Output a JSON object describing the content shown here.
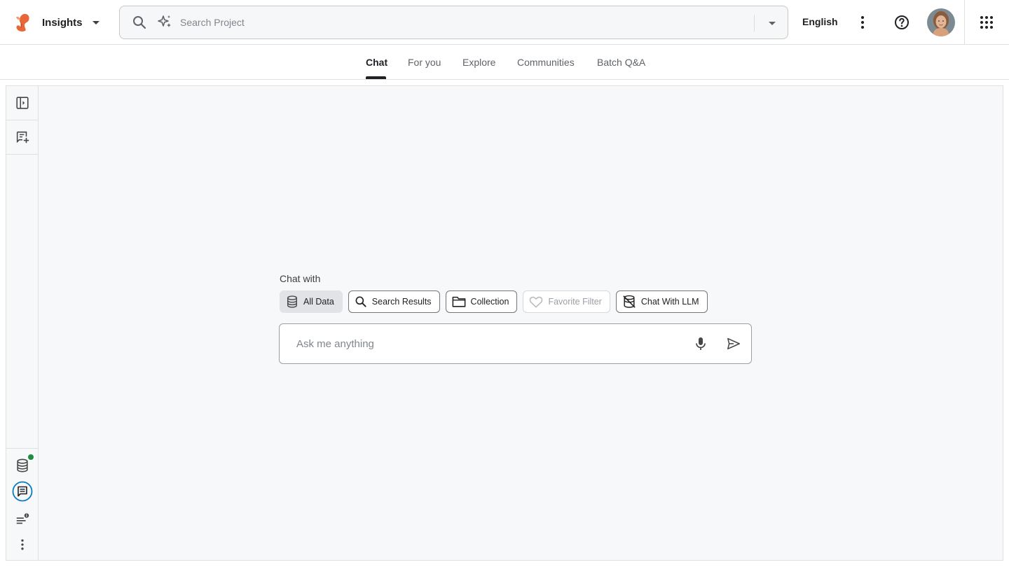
{
  "header": {
    "app_name": "Insights",
    "logo_icon": "squirrel-logo-icon",
    "search": {
      "placeholder": "Search Project",
      "value": ""
    },
    "language": "English",
    "icons": [
      "search-icon",
      "sparkle-icon",
      "dropdown-caret-icon",
      "more-vert-icon",
      "help-icon",
      "avatar",
      "apps-grid-icon"
    ]
  },
  "tabs": [
    {
      "label": "Chat",
      "active": true
    },
    {
      "label": "For you",
      "active": false
    },
    {
      "label": "Explore",
      "active": false
    },
    {
      "label": "Communities",
      "active": false
    },
    {
      "label": "Batch Q&A",
      "active": false
    }
  ],
  "sidebar": {
    "top_icons": [
      "expand-panel-icon",
      "new-chat-icon"
    ],
    "bottom_icons": [
      "database-icon",
      "chat-icon",
      "notes-info-icon",
      "more-vert-icon"
    ],
    "database_status_color": "#1e8e3e",
    "active_icon": "chat-icon"
  },
  "chat": {
    "chat_with_label": "Chat with",
    "chips": [
      {
        "label": "All Data",
        "icon": "database-icon",
        "state": "selected"
      },
      {
        "label": "Search Results",
        "icon": "search-icon",
        "state": "default"
      },
      {
        "label": "Collection",
        "icon": "folder-icon",
        "state": "default"
      },
      {
        "label": "Favorite Filter",
        "icon": "heart-icon",
        "state": "disabled"
      },
      {
        "label": "Chat With LLM",
        "icon": "llm-icon",
        "state": "default"
      }
    ],
    "input": {
      "placeholder": "Ask me anything",
      "value": ""
    }
  },
  "colors": {
    "accent": "#0b7ac4",
    "active_tab": "#202124",
    "panel_bg": "#f7f8fa",
    "logo_orange": "#e8673a"
  }
}
